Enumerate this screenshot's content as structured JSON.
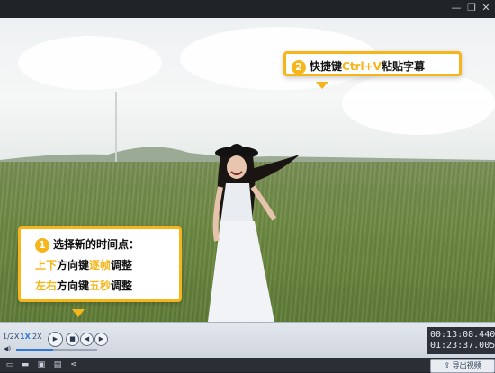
{
  "window": {
    "minimize_icon": "minimize-icon",
    "restore_icon": "restore-icon",
    "close_icon": "close-icon"
  },
  "callout_paste": {
    "number": "2",
    "text_before": "快捷键",
    "shortcut": "Ctrl+V",
    "text_after": "粘贴字幕"
  },
  "callout_time": {
    "number": "1",
    "line1": "选择新的时间点：",
    "line2_a": "上下",
    "line2_b": "方向键",
    "line2_c": "逐帧",
    "line2_d": "调整",
    "line3_a": "左右",
    "line3_b": "方向键",
    "line3_c": "五秒",
    "line3_d": "调整"
  },
  "playback": {
    "progress": 0.15,
    "speeds": [
      "1/2X",
      "1X",
      "2X"
    ],
    "active_speed": "1X",
    "volume": 0.45,
    "current_time": "00:13:08.440",
    "total_time": "01:23:37.005"
  },
  "toolbar_icons": [
    "new-file-icon",
    "open-folder-icon",
    "save-icon",
    "save-as-icon",
    "share-icon"
  ],
  "export": {
    "label": "导出视频",
    "icon": "export-icon"
  },
  "colors": {
    "accent_yellow": "#f5b51b",
    "progress_blue": "#2f7ad8"
  }
}
